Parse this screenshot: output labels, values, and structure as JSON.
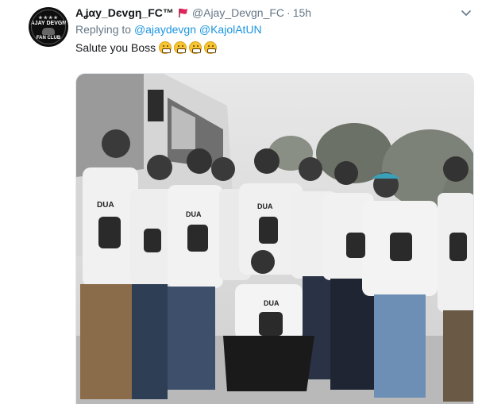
{
  "tweet": {
    "avatar": {
      "icon": "fan-club-logo",
      "logo_text": [
        "AJAY DEVGN",
        "FAN CLUB"
      ]
    },
    "display_name": "Aʝαу_Dєvgη_FC™",
    "badge_icon": "red-flag-icon",
    "handle": "@Ajay_Devgn_FC",
    "separator": "·",
    "time": "15h",
    "menu_icon": "chevron-down-icon",
    "replying_to_label": "Replying to",
    "reply_mentions": [
      "@ajaydevgn",
      "@KajolAtUN"
    ],
    "text": "Salute you Boss",
    "emoji_count": 4,
    "emoji_name": "grimacing-face",
    "media": {
      "type": "photo",
      "description_icon": "group-photo",
      "tshirt_text": "DUA"
    },
    "colors": {
      "link": "#1b95e0",
      "secondary_text": "#657786",
      "primary_text": "#14171a",
      "badge": "#e0245e"
    }
  }
}
